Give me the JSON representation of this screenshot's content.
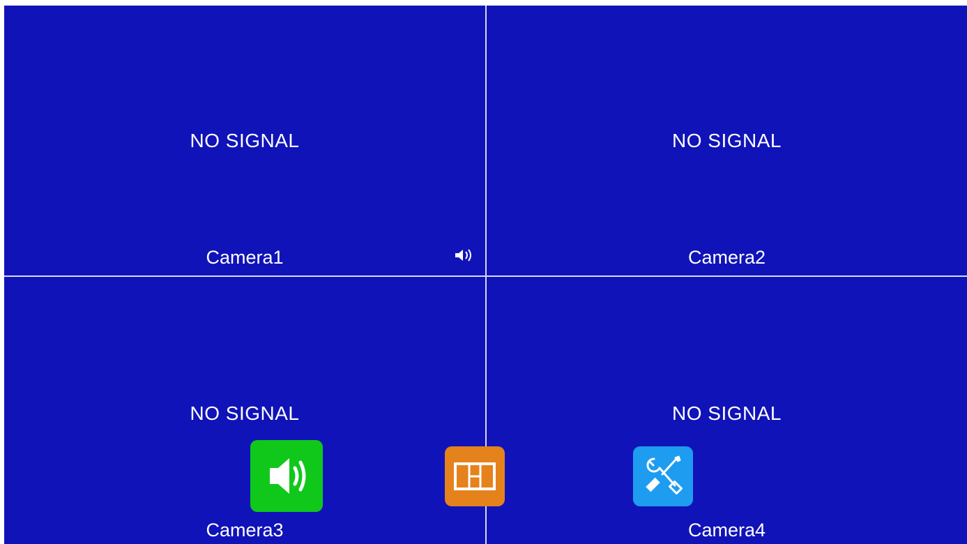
{
  "screen": {
    "background_color": "#1013b8",
    "divider_color": "#d8d8ee"
  },
  "quadrants": [
    {
      "status": "NO SIGNAL",
      "label": "Camera1",
      "audio_icon": "speaker-small-icon"
    },
    {
      "status": "NO SIGNAL",
      "label": "Camera2"
    },
    {
      "status": "NO SIGNAL",
      "label": "Camera3"
    },
    {
      "status": "NO SIGNAL",
      "label": "Camera4"
    }
  ],
  "dock": {
    "volume_button": {
      "icon": "speaker-icon",
      "color": "#10c81a"
    },
    "layout_button": {
      "icon": "split-layout-icon",
      "color": "#e5821c"
    },
    "settings_button": {
      "icon": "wrench-screwdriver-icon",
      "color": "#1e9cf0"
    }
  }
}
